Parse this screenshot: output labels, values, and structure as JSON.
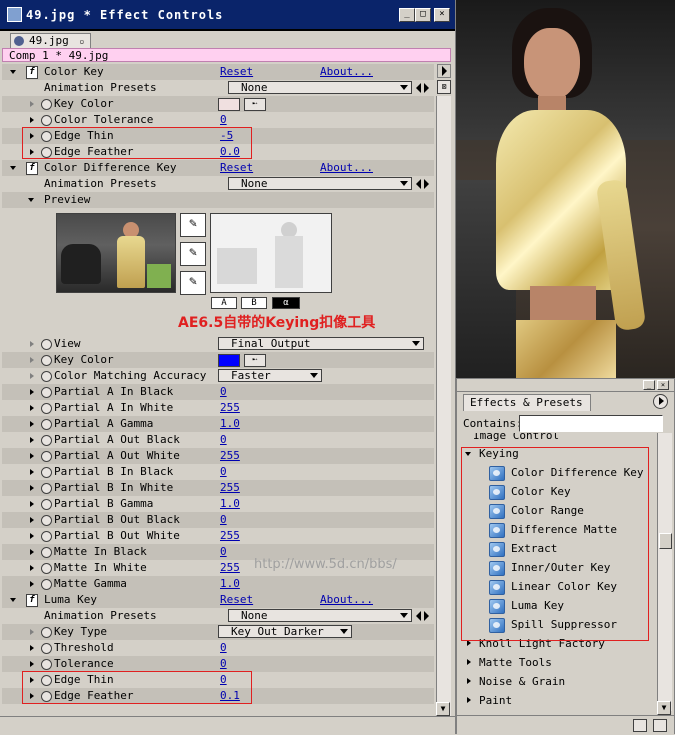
{
  "ec": {
    "title": "49.jpg * Effect Controls",
    "tab": "49.jpg",
    "comp": "Comp 1 * 49.jpg"
  },
  "color_key": {
    "name": "Color Key",
    "reset": "Reset",
    "about": "About...",
    "presets_label": "Animation Presets",
    "presets_value": "None",
    "rows": [
      {
        "label": "Key Color",
        "value": ""
      },
      {
        "label": "Color Tolerance",
        "value": "0"
      },
      {
        "label": "Edge Thin",
        "value": "-5"
      },
      {
        "label": "Edge Feather",
        "value": "0.0"
      }
    ],
    "key_color": "#f0e0e0"
  },
  "cdk": {
    "name": "Color Difference Key",
    "reset": "Reset",
    "about": "About...",
    "presets_label": "Animation Presets",
    "presets_value": "None",
    "preview_label": "Preview",
    "buttons": [
      "A",
      "B",
      "α"
    ],
    "annotation": "AE6.5自带的Keying扣像工具",
    "view_label": "View",
    "view_value": "Final Output",
    "keycolor_label": "Key Color",
    "key_color": "#0000ff",
    "cma_label": "Color Matching Accuracy",
    "cma_value": "Faster",
    "params": [
      {
        "label": "Partial A In Black",
        "value": "0"
      },
      {
        "label": "Partial A In White",
        "value": "255"
      },
      {
        "label": "Partial A Gamma",
        "value": "1.0"
      },
      {
        "label": "Partial A Out Black",
        "value": "0"
      },
      {
        "label": "Partial A Out White",
        "value": "255"
      },
      {
        "label": "Partial B In Black",
        "value": "0"
      },
      {
        "label": "Partial B In White",
        "value": "255"
      },
      {
        "label": "Partial B Gamma",
        "value": "1.0"
      },
      {
        "label": "Partial B Out Black",
        "value": "0"
      },
      {
        "label": "Partial B Out White",
        "value": "255"
      },
      {
        "label": "Matte In Black",
        "value": "0"
      },
      {
        "label": "Matte In White",
        "value": "255"
      },
      {
        "label": "Matte Gamma",
        "value": "1.0"
      }
    ],
    "watermark": "http://www.5d.cn/bbs/"
  },
  "luma_key": {
    "name": "Luma Key",
    "reset": "Reset",
    "about": "About...",
    "presets_label": "Animation Presets",
    "presets_value": "None",
    "keytype_label": "Key Type",
    "keytype_value": "Key Out Darker",
    "rows": [
      {
        "label": "Threshold",
        "value": "0"
      },
      {
        "label": "Tolerance",
        "value": "0"
      },
      {
        "label": "Edge Thin",
        "value": "0"
      },
      {
        "label": "Edge Feather",
        "value": "0.1"
      }
    ]
  },
  "fp": {
    "tab": "Effects & Presets",
    "contains_label": "Contains:",
    "cut_item": "Image Control",
    "keying": "Keying",
    "keying_items": [
      "Color Difference Key",
      "Color Key",
      "Color Range",
      "Difference Matte",
      "Extract",
      "Inner/Outer Key",
      "Linear Color Key",
      "Luma Key",
      "Spill Suppressor"
    ],
    "folders": [
      "Knoll Light Factory",
      "Matte Tools",
      "Noise & Grain",
      "Paint"
    ]
  },
  "colors": {
    "title_bar": "#0a246a",
    "link": "#0000b0",
    "highlight": "#e02020"
  }
}
